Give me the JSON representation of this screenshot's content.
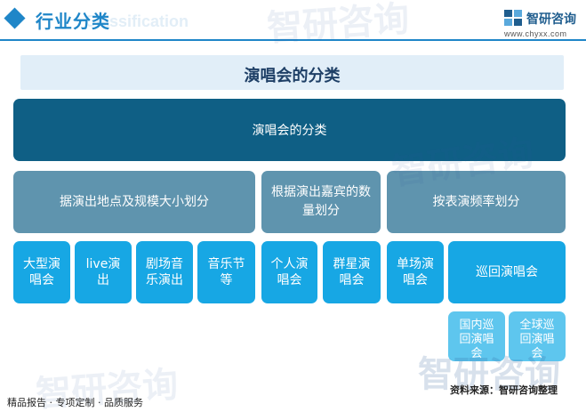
{
  "header": {
    "title": "行业分类",
    "title_en": "Classification",
    "brand_name": "智研咨询",
    "brand_url": "www.chyxx.com"
  },
  "watermark": {
    "text": "智研咨询"
  },
  "panel": {
    "title": "演唱会的分类"
  },
  "diagram": {
    "root": "演唱会的分类",
    "groups": [
      {
        "label": "据演出地点及规模大小划分",
        "children": [
          "大型演唱会",
          "live演出",
          "剧场音乐演出",
          "音乐节等"
        ]
      },
      {
        "label": "根据演出嘉宾的数量划分",
        "children": [
          "个人演唱会",
          "群星演唱会"
        ]
      },
      {
        "label": "按表演频率划分",
        "children": [
          "单场演唱会",
          "巡回演唱会"
        ]
      }
    ],
    "tour_children": [
      "国内巡回演唱会",
      "全球巡回演唱会"
    ]
  },
  "footer": {
    "left": "精品报告 · 专项定制 · 品质服务",
    "source": "资料来源：智研咨询整理"
  },
  "colors": {
    "accent": "#1f86c8",
    "root_box": "#0f5f85",
    "group_box": "#5f94ae",
    "leaf_box": "#17a7e4",
    "sub_leaf_box": "#5ec6ee"
  }
}
